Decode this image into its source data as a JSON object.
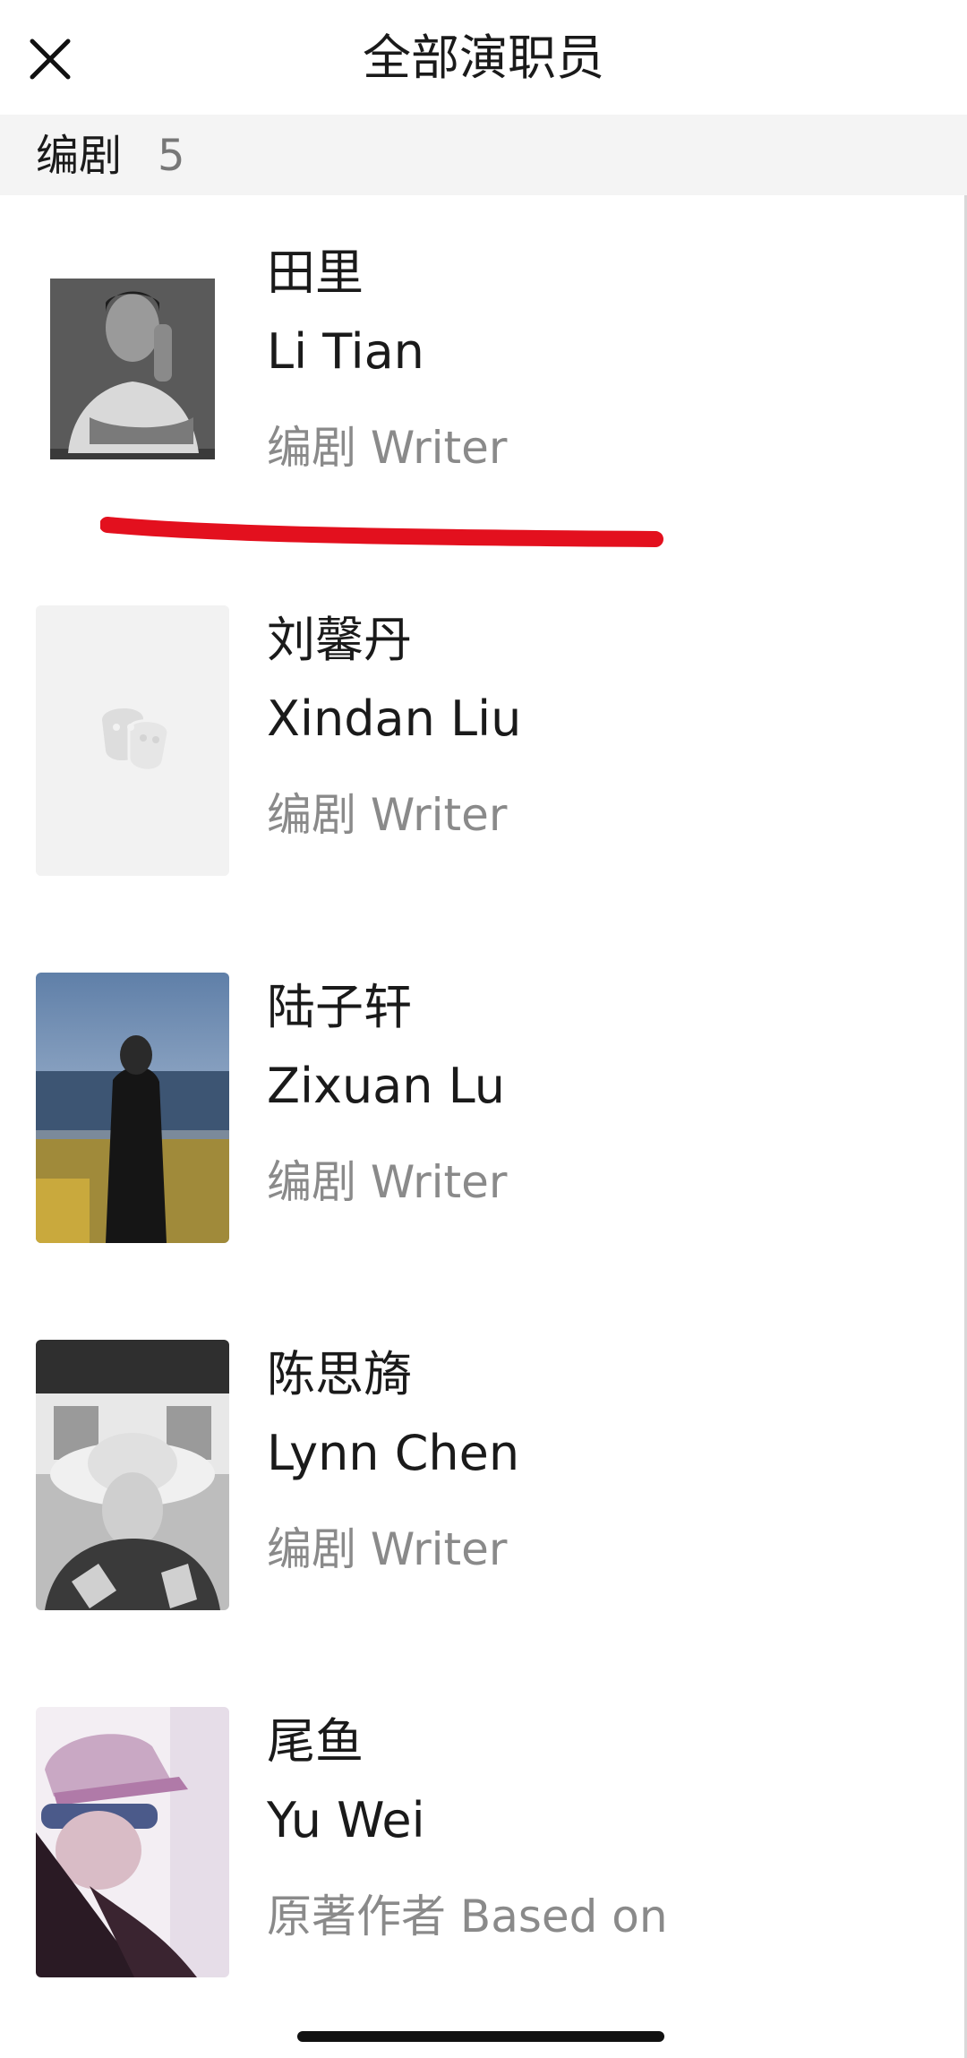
{
  "header": {
    "title": "全部演职员",
    "close_icon": "close-icon"
  },
  "section": {
    "label": "编剧",
    "count": "5"
  },
  "members": [
    {
      "name_cn": "田里",
      "name_en": "Li Tian",
      "role": "编剧 Writer",
      "photo": "bw-portrait"
    },
    {
      "name_cn": "刘馨丹",
      "name_en": "Xindan Liu",
      "role": "编剧 Writer",
      "photo": "theater-masks-placeholder-icon"
    },
    {
      "name_cn": "陆子轩",
      "name_en": "Zixuan Lu",
      "role": "编剧 Writer",
      "photo": "harbor-portrait"
    },
    {
      "name_cn": "陈思旖",
      "name_en": "Lynn Chen",
      "role": "编剧 Writer",
      "photo": "hat-portrait"
    },
    {
      "name_cn": "尾鱼",
      "name_en": "Yu Wei",
      "role": "原著作者 Based on",
      "photo": "cap-portrait"
    }
  ],
  "colors": {
    "underline_annotation": "#e3101e",
    "section_bar_bg": "#f4f4f4",
    "secondary_text": "#8a8a8a"
  }
}
